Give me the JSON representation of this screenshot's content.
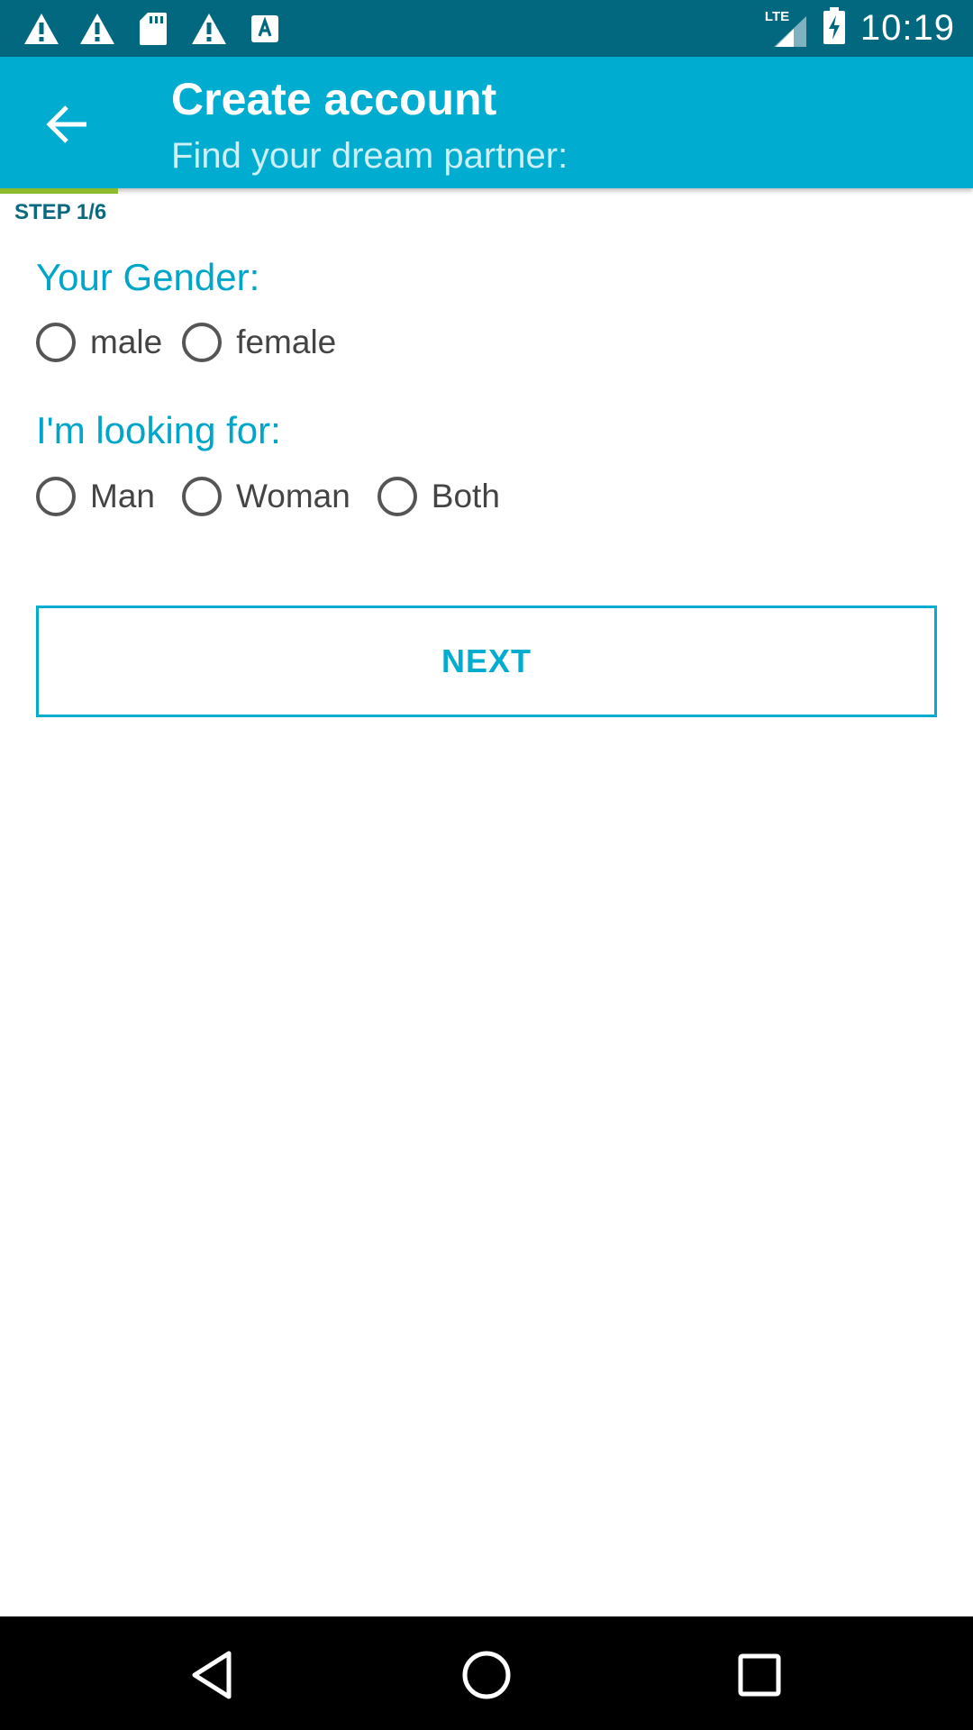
{
  "status_bar": {
    "time": "10:19",
    "network": "LTE",
    "icons": [
      "warning-icon",
      "warning-icon",
      "sd-card-icon",
      "warning-icon",
      "font-download-icon"
    ]
  },
  "app_bar": {
    "back_icon": "arrow-back-icon",
    "title": "Create account",
    "subtitle": "Find your dream partner:"
  },
  "step": {
    "label": "STEP 1/6",
    "progress": 0.1667
  },
  "gender": {
    "heading": "Your Gender:",
    "options": [
      "male",
      "female"
    ],
    "selected": null
  },
  "looking_for": {
    "heading": "I'm looking for:",
    "options": [
      "Man",
      "Woman",
      "Both"
    ],
    "selected": null
  },
  "next_button": {
    "label": "NEXT"
  },
  "nav_bar": {
    "icons": [
      "back-triangle-icon",
      "home-circle-icon",
      "recents-square-icon"
    ]
  },
  "colors": {
    "status_bar": "#02687f",
    "app_bar": "#00acd0",
    "accent": "#00acd0",
    "progress": "#8cbc2c"
  }
}
